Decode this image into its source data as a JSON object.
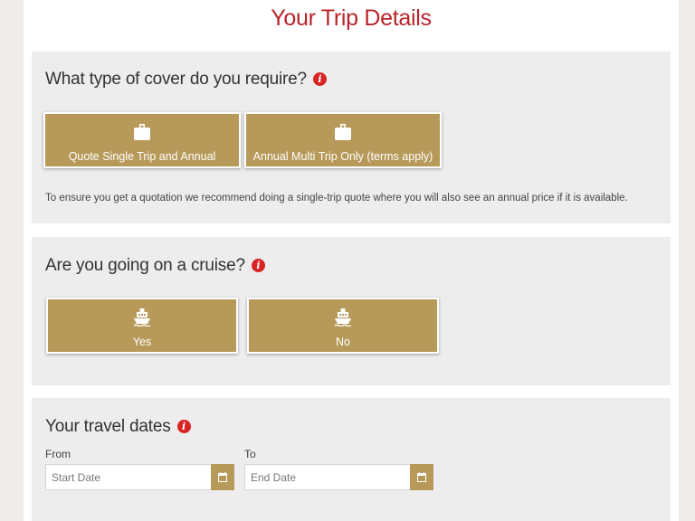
{
  "page": {
    "title": "Your Trip Details"
  },
  "cover": {
    "question": "What type of cover do you require?",
    "options": [
      {
        "label": "Quote Single Trip and Annual",
        "icon": "suitcase-icon"
      },
      {
        "label": "Annual Multi Trip Only (terms apply)",
        "icon": "suitcase-icon"
      }
    ],
    "note": "To ensure you get a quotation we recommend doing a single-trip quote where you will also see an annual price if it is available."
  },
  "cruise": {
    "question": "Are you going on a cruise?",
    "options": [
      {
        "label": "Yes",
        "icon": "ship-icon"
      },
      {
        "label": "No",
        "icon": "ship-icon"
      }
    ]
  },
  "dates": {
    "question": "Your travel dates",
    "from": {
      "label": "From",
      "placeholder": "Start Date"
    },
    "to": {
      "label": "To",
      "placeholder": "End Date"
    }
  },
  "info_icon_glyph": "i",
  "colors": {
    "title": "#b8242a",
    "button": "#b7995a",
    "info": "#d92424",
    "section_bg": "#ededed"
  }
}
